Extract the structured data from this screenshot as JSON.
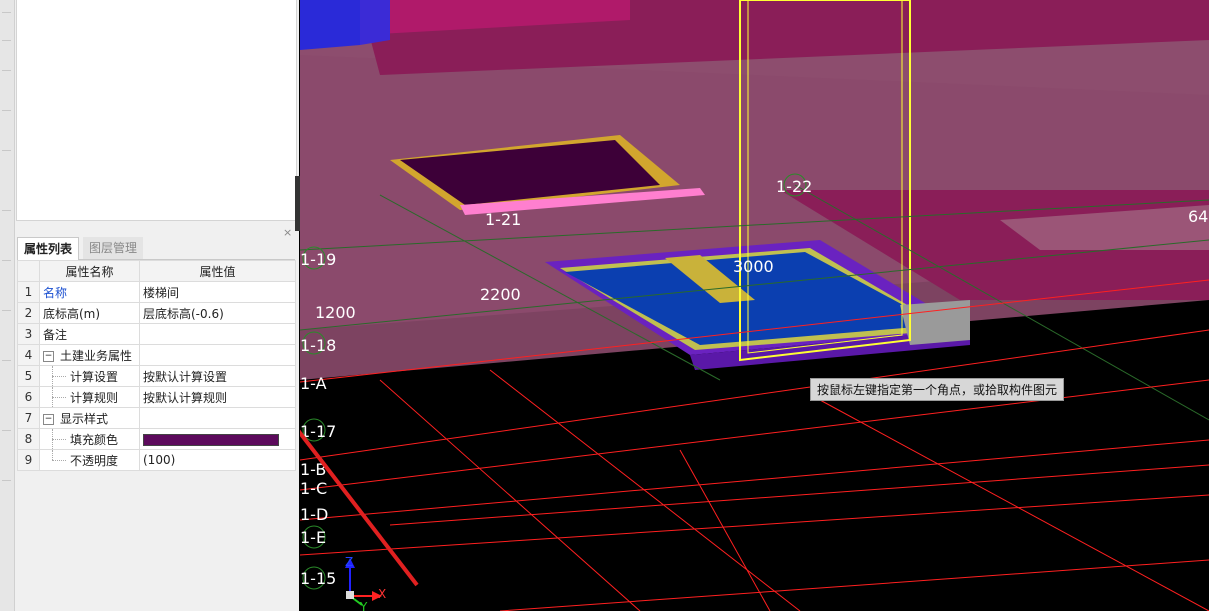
{
  "panel": {
    "close_glyph": "×",
    "tabs": [
      {
        "label": "属性列表",
        "active": true
      },
      {
        "label": "图层管理",
        "active": false
      }
    ],
    "grid": {
      "header": {
        "name": "属性名称",
        "value": "属性值"
      },
      "rows": [
        {
          "num": "1",
          "name": "名称",
          "value": "楼梯间"
        },
        {
          "num": "2",
          "name": "底标高(m)",
          "value": "层底标高(-0.6)"
        },
        {
          "num": "3",
          "name": "备注",
          "value": ""
        },
        {
          "num": "4",
          "name": "土建业务属性",
          "value": "",
          "expander": "−"
        },
        {
          "num": "5",
          "name": "计算设置",
          "value": "按默认计算设置"
        },
        {
          "num": "6",
          "name": "计算规则",
          "value": "按默认计算规则"
        },
        {
          "num": "7",
          "name": "显示样式",
          "value": "",
          "expander": "−"
        },
        {
          "num": "8",
          "name": "填充颜色",
          "value_color": "#5c0a5c"
        },
        {
          "num": "9",
          "name": "不透明度",
          "value": "(100)"
        }
      ]
    }
  },
  "viewport": {
    "axis_labels": [
      "1-19",
      "1-18",
      "1-A",
      "1-17",
      "1-B",
      "1-C",
      "1-D",
      "1-E",
      "1-15",
      "1-21",
      "1-22"
    ],
    "dimensions": [
      "1200",
      "2200",
      "3000",
      "64"
    ],
    "tooltip": "按鼠标左键指定第一个角点，或拾取构件图元",
    "gizmo": {
      "z": "Z",
      "x": "X",
      "y": "Y"
    },
    "colors": {
      "slab": "#8d4d6e",
      "beam": "#8a1e58",
      "stair_blue": "#0b3fb0",
      "selection_yellow": "#ffff33",
      "grid_red": "#ff2020",
      "grid_green": "#2a6a2a"
    }
  }
}
